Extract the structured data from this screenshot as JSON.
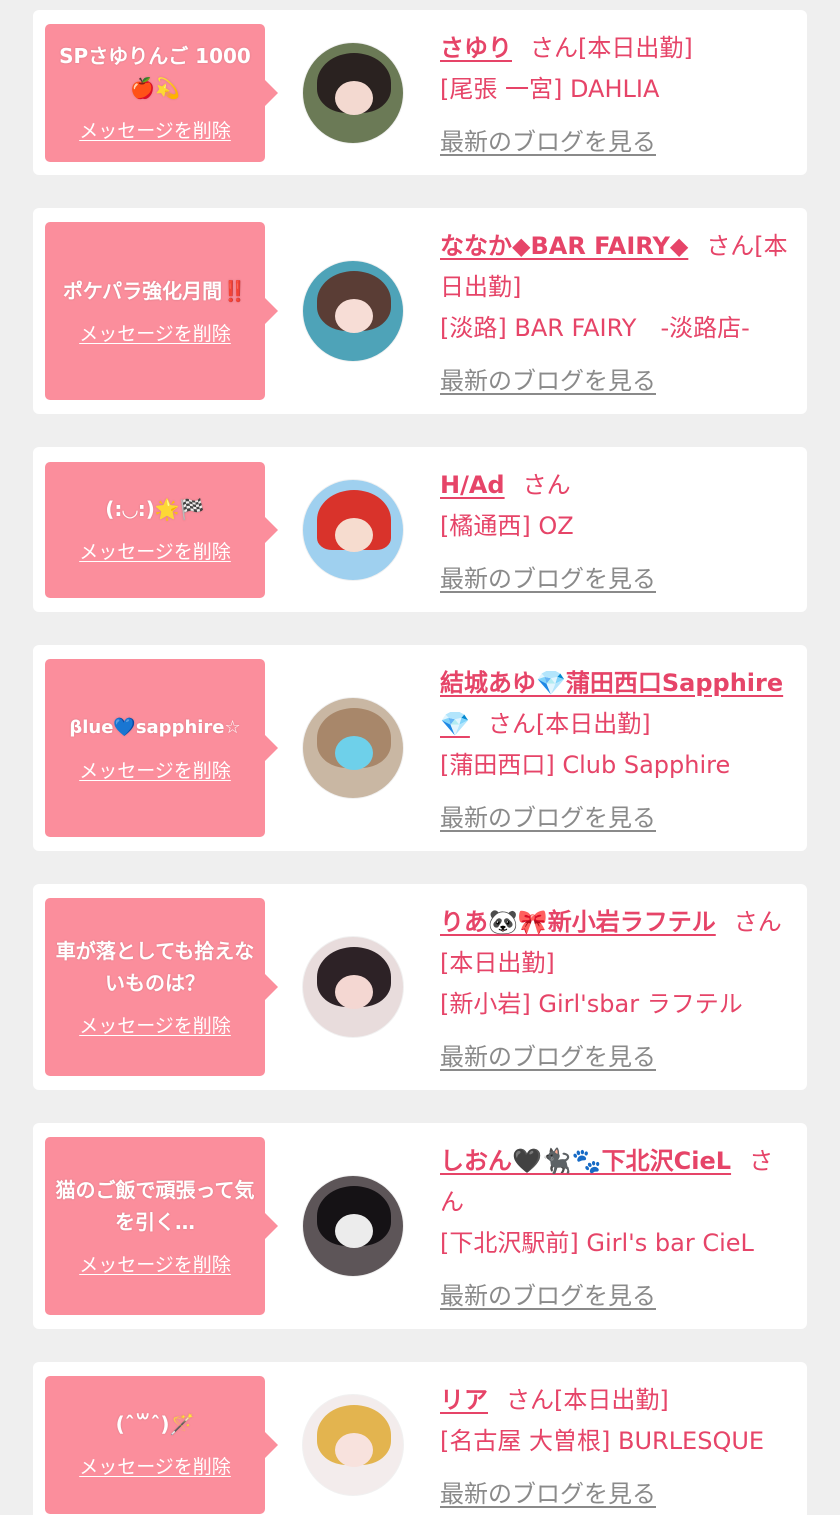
{
  "cards": [
    {
      "message": "SPさゆりんご 1000🍎💫",
      "delete_label": "メッセージを削除",
      "name": "さゆり",
      "suffix": "さん[本日出勤]",
      "shop": "[尾張 一宮] DAHLIA",
      "blog_label": "最新のブログを見る",
      "avatar": "user-photo"
    },
    {
      "message": "ポケパラ強化月間‼️",
      "delete_label": "メッセージを削除",
      "name": "ななか◆BAR FAIRY◆",
      "suffix": "さん[本日出勤]",
      "shop": "[淡路] BAR FAIRY　-淡路店-",
      "blog_label": "最新のブログを見る",
      "avatar": "user-photo"
    },
    {
      "message": "(:◡:)🌟🏁",
      "delete_label": "メッセージを削除",
      "name": "H/Ad",
      "suffix": "さん",
      "shop": "[橘通西] OZ",
      "blog_label": "最新のブログを見る",
      "avatar": "user-photo"
    },
    {
      "message": "βlue💙sapphire☆",
      "delete_label": "メッセージを削除",
      "name": "結城あゆ💎蒲田西口Sapphire💎",
      "suffix": "さん[本日出勤]",
      "shop": "[蒲田西口] Club Sapphire",
      "blog_label": "最新のブログを見る",
      "avatar": "user-photo"
    },
    {
      "message": "車が落としても拾えないものは？",
      "delete_label": "メッセージを削除",
      "name": "りあ🐼🎀新小岩ラフテル",
      "suffix": "さん[本日出勤]",
      "shop": "[新小岩] Girl'sbar ラフテル",
      "blog_label": "最新のブログを見る",
      "avatar": "user-photo"
    },
    {
      "message": "猫のご飯で頑張って気を引く…",
      "delete_label": "メッセージを削除",
      "name": "しおん🖤🐈‍⬛🐾下北沢CieL",
      "suffix": "さん",
      "shop": "[下北沢駅前] Girl's bar CieL",
      "blog_label": "最新のブログを見る",
      "avatar": "user-photo"
    },
    {
      "message": "(ˆ꒳ˆ)🪄",
      "delete_label": "メッセージを削除",
      "name": "リア",
      "suffix": "さん[本日出勤]",
      "shop": "[名古屋 大曽根] BURLESQUE",
      "blog_label": "最新のブログを見る",
      "avatar": "user-photo"
    }
  ],
  "colors": {
    "accent": "#e64468",
    "bubble": "#fb8e9c",
    "link_gray": "#8a8a8a",
    "background": "#efefef"
  }
}
